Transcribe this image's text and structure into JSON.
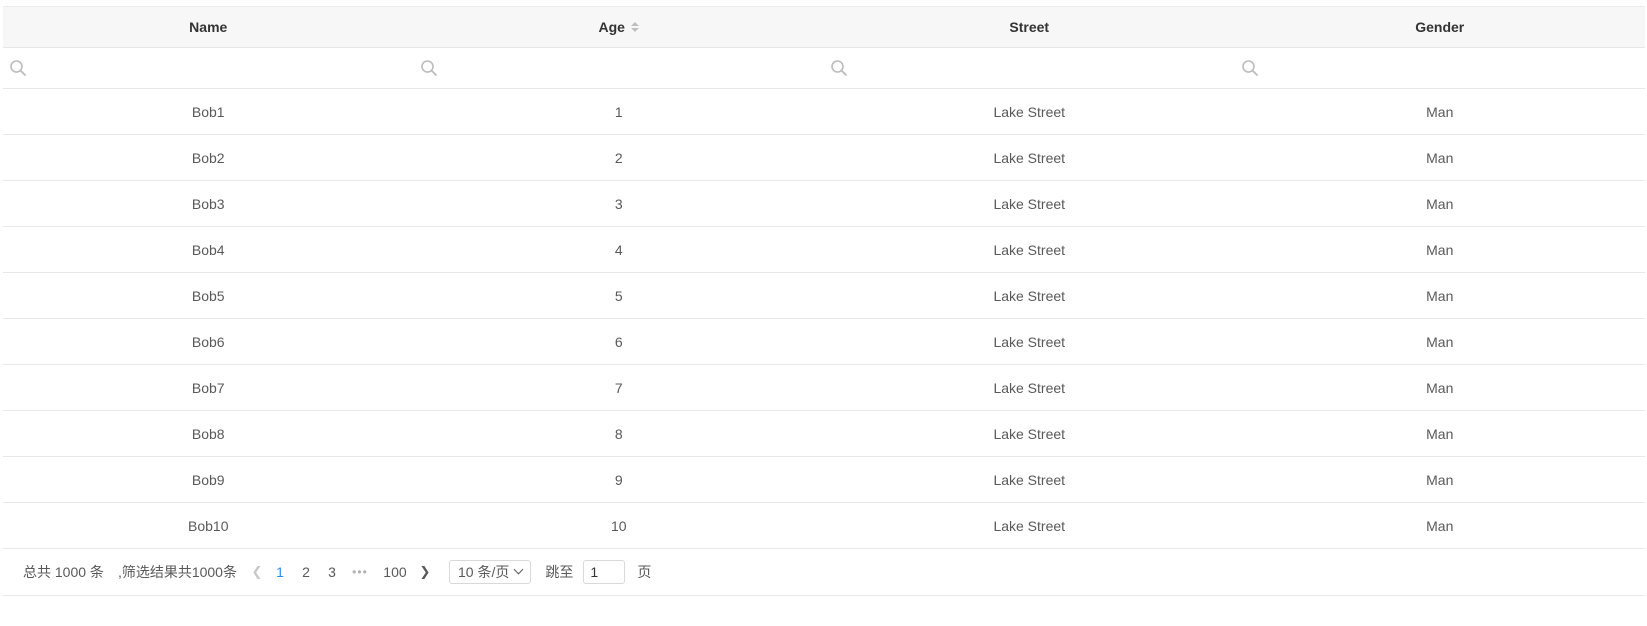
{
  "table": {
    "columns": [
      {
        "label": "Name",
        "sortable": false
      },
      {
        "label": "Age",
        "sortable": true
      },
      {
        "label": "Street",
        "sortable": false
      },
      {
        "label": "Gender",
        "sortable": false
      }
    ],
    "rows": [
      [
        "Bob1",
        "1",
        "Lake Street",
        "Man"
      ],
      [
        "Bob2",
        "2",
        "Lake Street",
        "Man"
      ],
      [
        "Bob3",
        "3",
        "Lake Street",
        "Man"
      ],
      [
        "Bob4",
        "4",
        "Lake Street",
        "Man"
      ],
      [
        "Bob5",
        "5",
        "Lake Street",
        "Man"
      ],
      [
        "Bob6",
        "6",
        "Lake Street",
        "Man"
      ],
      [
        "Bob7",
        "7",
        "Lake Street",
        "Man"
      ],
      [
        "Bob8",
        "8",
        "Lake Street",
        "Man"
      ],
      [
        "Bob9",
        "9",
        "Lake Street",
        "Man"
      ],
      [
        "Bob10",
        "10",
        "Lake Street",
        "Man"
      ]
    ],
    "filter_icon": "search-icon",
    "sort_icon": "sort-icon"
  },
  "pagination": {
    "total_text": "总共 1000 条",
    "filter_total_text": ",筛选结果共1000条",
    "prev_icon": "chevron-left-icon",
    "pages": [
      "1",
      "2",
      "3"
    ],
    "ellipsis": "•••",
    "last_page": "100",
    "next_icon": "chevron-right-icon",
    "current_page": 1,
    "page_size_label": "10 条/页",
    "jump_label": "跳至",
    "jump_value": "1",
    "page_suffix": "页"
  },
  "colors": {
    "active_page": "#2d8cf0",
    "header_bg": "#f7f7f7",
    "border": "#e8e8e8"
  }
}
